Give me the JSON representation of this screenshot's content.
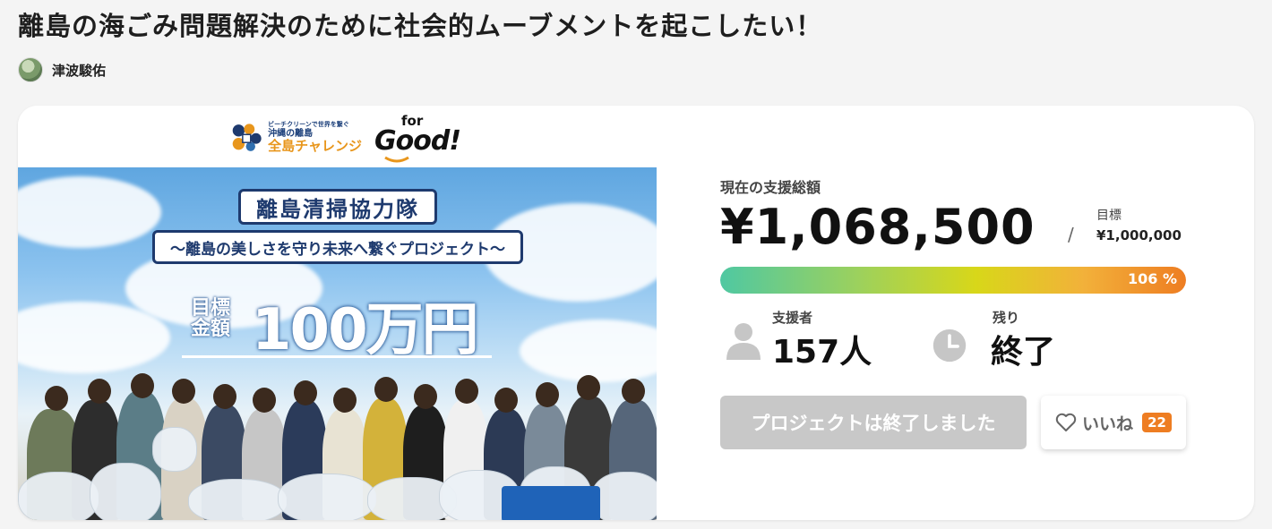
{
  "project": {
    "title": "離島の海ごみ問題解決のために社会的ムーブメントを起こしたい！",
    "owner": "津波駿佑"
  },
  "logos": {
    "challenge_small": "ビーチクリーンで世界を繋ぐ",
    "challenge_main": "全島チャレンジ",
    "challenge_sub": "沖縄の離島",
    "forgood_for": "for",
    "forgood_good": "Good!"
  },
  "hero": {
    "banner_title": "離島清掃協力隊",
    "banner_subtitle": "～離島の美しさを守り未来へ繋ぐプロジェクト～",
    "goal_label": "目標金額",
    "goal_amount": "100万円"
  },
  "funding": {
    "amount_label": "現在の支援総額",
    "amount": "¥1,068,500",
    "separator": "/",
    "target_label": "目標",
    "target_value": "¥1,000,000",
    "progress_percent_label": "106 %",
    "progress_fraction": 1.0,
    "colors": {
      "progress_start": "#4fc8a2",
      "progress_end": "#ee7d22"
    }
  },
  "stats": {
    "supporters_label": "支援者",
    "supporters_value": "157人",
    "remaining_label": "残り",
    "remaining_value": "終了"
  },
  "actions": {
    "ended_button": "プロジェクトは終了しました",
    "like_label": "いいね",
    "like_count": "22"
  },
  "icons": {
    "supporters": "person-icon",
    "remaining": "clock-icon",
    "like": "heart-icon"
  }
}
